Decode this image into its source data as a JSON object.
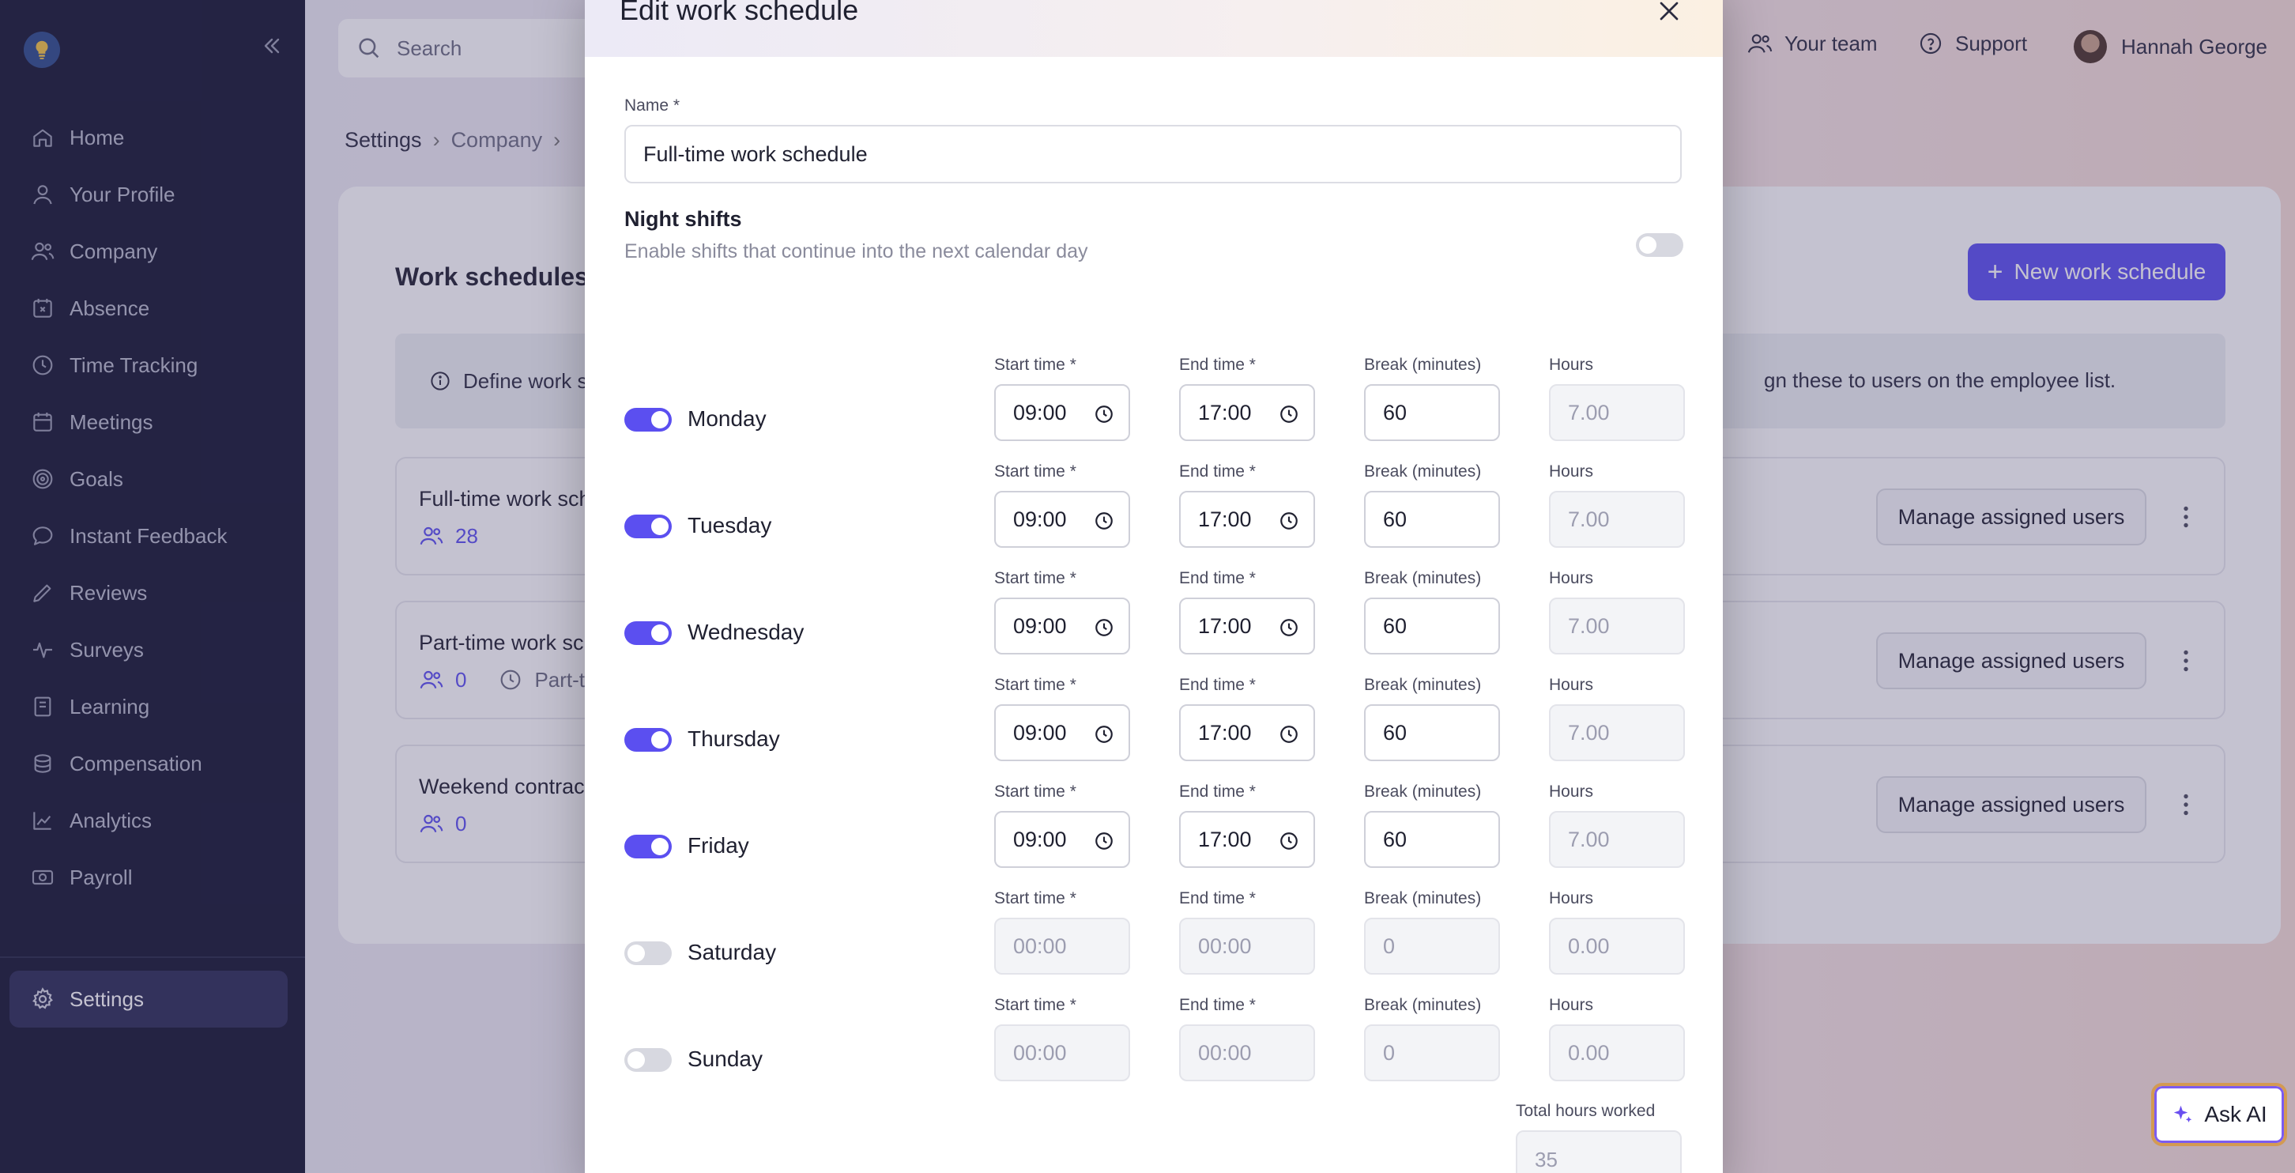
{
  "sidebar": {
    "items": [
      {
        "label": "Home",
        "icon": "home-icon"
      },
      {
        "label": "Your Profile",
        "icon": "user-icon"
      },
      {
        "label": "Company",
        "icon": "users-icon"
      },
      {
        "label": "Absence",
        "icon": "calendar-x-icon"
      },
      {
        "label": "Time Tracking",
        "icon": "clock-icon"
      },
      {
        "label": "Meetings",
        "icon": "calendar-icon"
      },
      {
        "label": "Goals",
        "icon": "target-icon"
      },
      {
        "label": "Instant Feedback",
        "icon": "chat-icon"
      },
      {
        "label": "Reviews",
        "icon": "pen-icon"
      },
      {
        "label": "Surveys",
        "icon": "pulse-icon"
      },
      {
        "label": "Learning",
        "icon": "book-icon"
      },
      {
        "label": "Compensation",
        "icon": "coins-icon"
      },
      {
        "label": "Analytics",
        "icon": "chart-icon"
      },
      {
        "label": "Payroll",
        "icon": "money-icon"
      }
    ],
    "settings_label": "Settings"
  },
  "topbar": {
    "search_placeholder": "Search",
    "team_label": "Your team",
    "support_label": "Support",
    "user_name": "Hannah George"
  },
  "breadcrumb": {
    "settings": "Settings",
    "company": "Company"
  },
  "page": {
    "title": "Work schedules",
    "new_button": "New work schedule",
    "info_text": "Define work s",
    "info_tail": "gn these to users on the employee list.",
    "schedules": [
      {
        "name": "Full-time work sch",
        "count": "28",
        "extra": ""
      },
      {
        "name": "Part-time work sc",
        "count": "0",
        "extra": "Part-t"
      },
      {
        "name": "Weekend contrac",
        "count": "0",
        "extra": ""
      }
    ],
    "manage_label": "Manage assigned users",
    "ask_ai": "Ask AI"
  },
  "modal": {
    "title": "Edit work schedule",
    "name_label": "Name *",
    "name_value": "Full-time work schedule",
    "night_title": "Night shifts",
    "night_desc": "Enable shifts that continue into the next calendar day",
    "night_enabled": false,
    "col_start": "Start time *",
    "col_end": "End time *",
    "col_break": "Break (minutes)",
    "col_hours": "Hours",
    "days": [
      {
        "name": "Monday",
        "enabled": true,
        "start": "09:00",
        "end": "17:00",
        "break": "60",
        "hours": "7.00"
      },
      {
        "name": "Tuesday",
        "enabled": true,
        "start": "09:00",
        "end": "17:00",
        "break": "60",
        "hours": "7.00"
      },
      {
        "name": "Wednesday",
        "enabled": true,
        "start": "09:00",
        "end": "17:00",
        "break": "60",
        "hours": "7.00"
      },
      {
        "name": "Thursday",
        "enabled": true,
        "start": "09:00",
        "end": "17:00",
        "break": "60",
        "hours": "7.00"
      },
      {
        "name": "Friday",
        "enabled": true,
        "start": "09:00",
        "end": "17:00",
        "break": "60",
        "hours": "7.00"
      },
      {
        "name": "Saturday",
        "enabled": false,
        "start": "00:00",
        "end": "00:00",
        "break": "0",
        "hours": "0.00"
      },
      {
        "name": "Sunday",
        "enabled": false,
        "start": "00:00",
        "end": "00:00",
        "break": "0",
        "hours": "0.00"
      }
    ],
    "total_label": "Total hours worked",
    "total_value": "35"
  },
  "colors": {
    "accent": "#5b4ff0",
    "sidebar_bg": "#141530",
    "sidebar_active": "#2a2b54"
  }
}
